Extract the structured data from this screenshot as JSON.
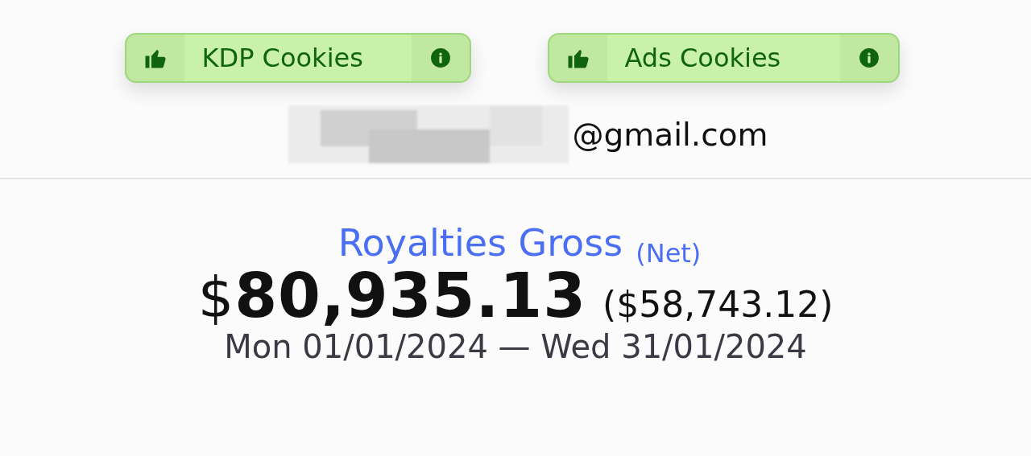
{
  "cookies": [
    {
      "label": "KDP Cookies",
      "valid": true
    },
    {
      "label": "Ads Cookies",
      "valid": true
    }
  ],
  "account": {
    "email_domain": "@gmail.com"
  },
  "royalties": {
    "title": "Royalties Gross",
    "net_label": "(Net)",
    "gross": "80,935.13",
    "currency": "$",
    "net": "($58,743.12)",
    "date_range": "Mon 01/01/2024 — Wed 31/01/2024"
  }
}
